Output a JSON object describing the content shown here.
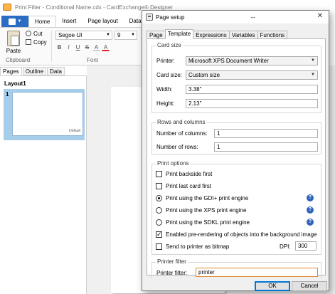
{
  "app": {
    "title": "Print Filter - Conditional Name.cdx - CardExchange® Designer",
    "ribbon_tabs": [
      "Home",
      "Insert",
      "Page layout",
      "Data"
    ],
    "clipboard": {
      "paste_label": "Paste",
      "cut_label": "Cut",
      "copy_label": "Copy",
      "group_label": "Clipboard"
    },
    "font": {
      "name": "Segoe UI",
      "size": "9",
      "group_label": "Font",
      "format_buttons": [
        "B",
        "I",
        "U",
        "S",
        "A",
        "A"
      ]
    },
    "panel_tabs": [
      "Pages",
      "Outline",
      "Data"
    ],
    "layout": {
      "name": "Layout1",
      "page_number": "1",
      "card_label": "Default"
    }
  },
  "dialog": {
    "title": "Page setup",
    "resize_glyph": "↔",
    "close_glyph": "✕",
    "tabs": [
      "Page",
      "Template",
      "Expressions",
      "Variables",
      "Functions"
    ],
    "active_tab": "Template",
    "card_size": {
      "title": "Card size",
      "printer_label": "Printer:",
      "printer_value": "Microsoft XPS Document Writer",
      "card_size_label": "Card size:",
      "card_size_value": "Custom size",
      "width_label": "Width:",
      "width_value": "3.38\"",
      "height_label": "Height:",
      "height_value": "2.13\""
    },
    "rows_columns": {
      "title": "Rows and columns",
      "columns_label": "Number of columns:",
      "columns_value": "1",
      "rows_label": "Number of rows:",
      "rows_value": "1"
    },
    "print_options": {
      "title": "Print options",
      "backside_first": "Print backside first",
      "last_card_first": "Print last card first",
      "gdi_engine": "Print using the GDI+ print engine",
      "xps_engine": "Print using the XPS print engine",
      "sdkl_engine": "Print using the SDKL print engine",
      "prerender": "Enabled pre-rendering of objects into the background image",
      "bitmap": "Send to printer as bitmap",
      "dpi_label": "DPI:",
      "dpi_value": "300",
      "help_glyph": "?"
    },
    "printer_filter": {
      "title": "Printer filter",
      "label": "Printer filter:",
      "value": "printer"
    },
    "ok_label": "OK",
    "cancel_label": "Cancel"
  }
}
